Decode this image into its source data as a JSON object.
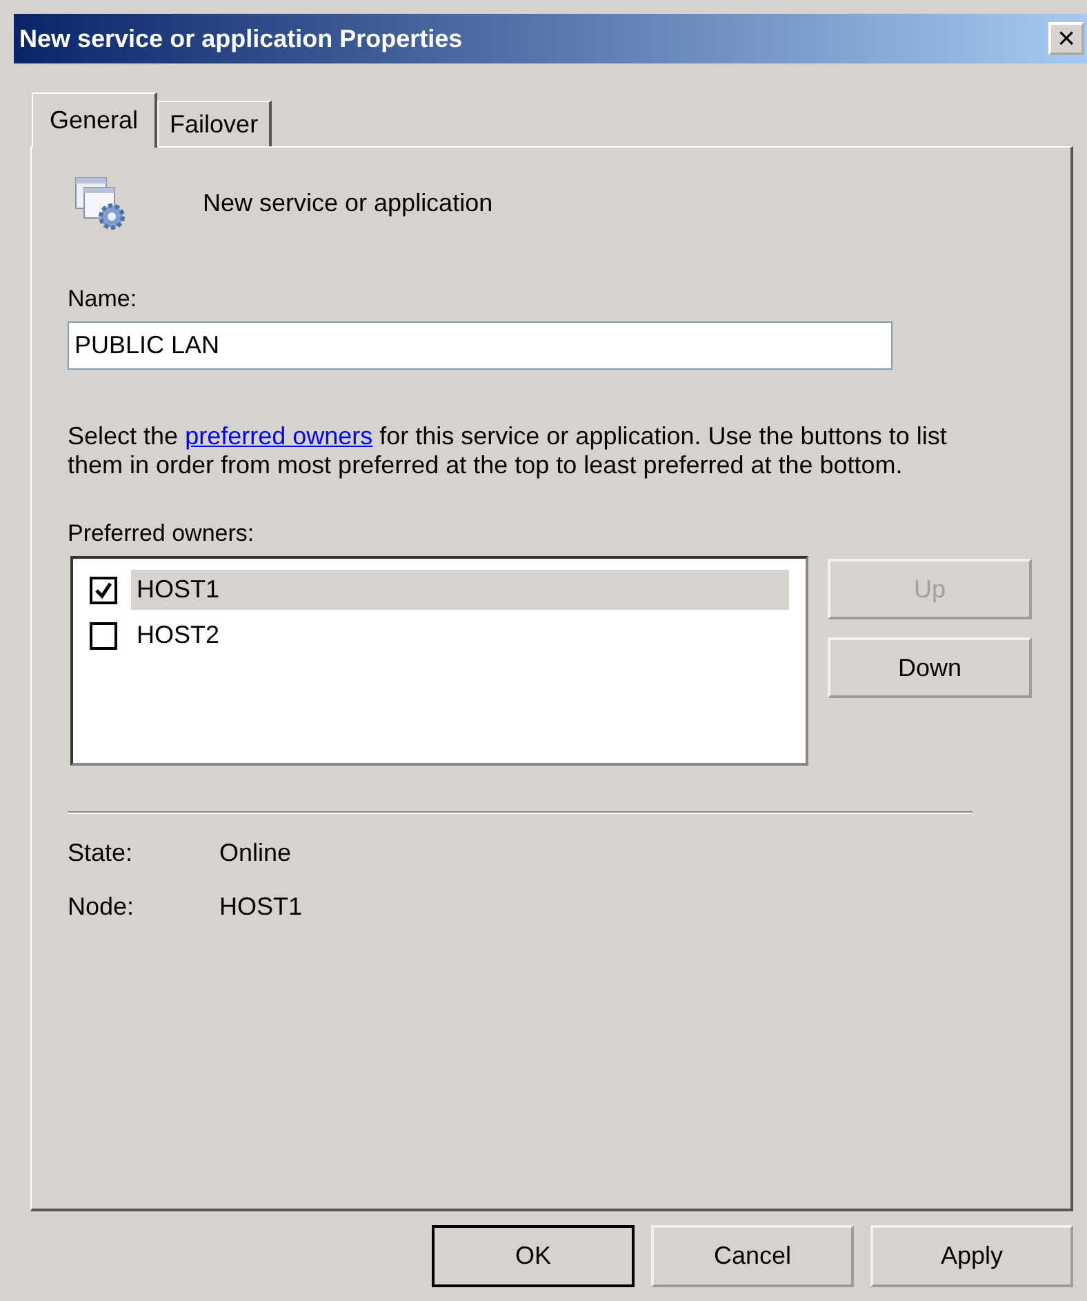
{
  "window": {
    "title": "New service or application Properties",
    "close": "×"
  },
  "tabs": [
    {
      "label": "General",
      "selected": true
    },
    {
      "label": "Failover",
      "selected": false
    }
  ],
  "header": {
    "name": "New service or application"
  },
  "name_field": {
    "label": "Name:",
    "value": "PUBLIC LAN"
  },
  "description": {
    "before": "Select the ",
    "link": "preferred owners",
    "after": " for this service or application. Use the buttons to list them in order from most preferred at the top to least preferred at the bottom."
  },
  "owners": {
    "label": "Preferred owners:",
    "items": [
      {
        "name": "HOST1",
        "checked": true,
        "selected": true
      },
      {
        "name": "HOST2",
        "checked": false,
        "selected": false
      }
    ],
    "buttons": [
      {
        "label": "Up",
        "disabled": true
      },
      {
        "label": "Down",
        "disabled": false
      }
    ]
  },
  "info": [
    {
      "label": "State:",
      "value": "Online"
    },
    {
      "label": "Node:",
      "value": "HOST1"
    }
  ],
  "buttons": [
    {
      "label": "OK",
      "default": true
    },
    {
      "label": "Cancel",
      "default": false
    },
    {
      "label": "Apply",
      "default": false
    }
  ]
}
